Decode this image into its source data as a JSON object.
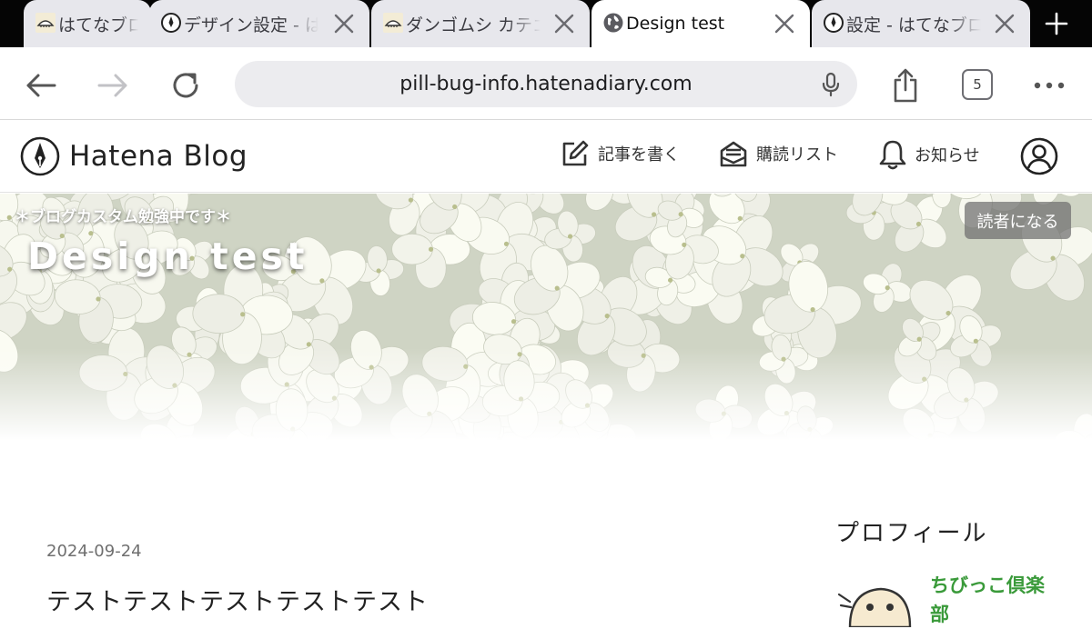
{
  "browser": {
    "tabs": [
      {
        "title": "はてなブログ",
        "favicon": "pillbug-icon",
        "active": false
      },
      {
        "title": "デザイン設定 - はてなブログ",
        "favicon": "hatena-pen-icon",
        "active": false
      },
      {
        "title": "ダンゴムシ カテゴリー",
        "favicon": "pillbug-icon",
        "active": false
      },
      {
        "title": "Design test",
        "favicon": "globe-icon",
        "active": true
      },
      {
        "title": "設定 - はてなブログ",
        "favicon": "hatena-pen-icon",
        "active": false
      }
    ],
    "url": "pill-bug-info.hatenadiary.com",
    "tab_count": "5"
  },
  "hatena": {
    "brand": "Hatena Blog",
    "nav": {
      "write": "記事を書く",
      "reading_list": "購読リスト",
      "notifications": "お知らせ"
    }
  },
  "hero": {
    "tagline": "＊ブログカスタム勉強中です＊",
    "title": "Design test",
    "subscribe": "読者になる"
  },
  "post": {
    "date": "2024-09-24",
    "title": "テストテストテストテストテスト"
  },
  "sidebar": {
    "profile_heading": "プロフィール",
    "profile_name": "ちびっこ倶楽部"
  },
  "colors": {
    "tab_strip": "#050505",
    "accent_green": "#3a9a3a"
  }
}
